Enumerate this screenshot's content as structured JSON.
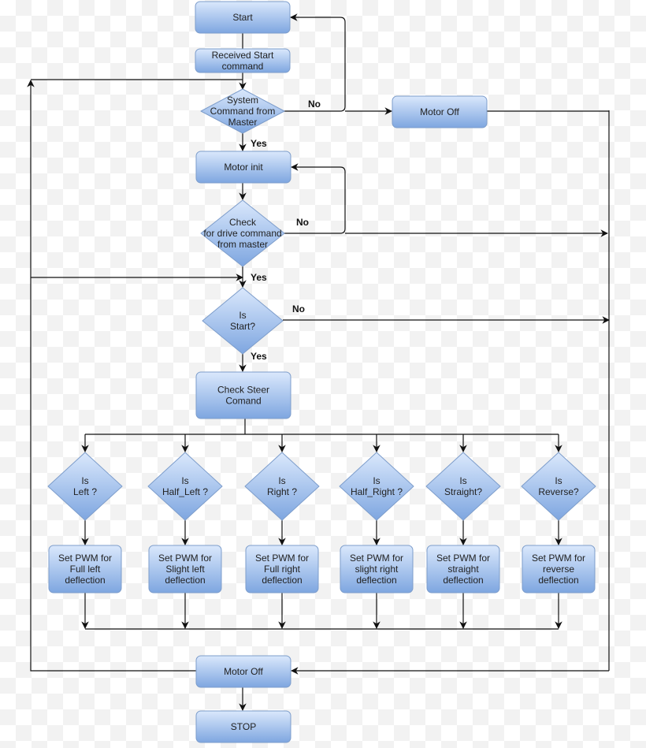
{
  "nodes": {
    "start": [
      "Start"
    ],
    "received": [
      "Received Start",
      "command"
    ],
    "system_cmd": [
      "System",
      "Command from",
      "Master"
    ],
    "motor_off_top": [
      "Motor Off"
    ],
    "motor_init": [
      "Motor init"
    ],
    "check_drive": [
      "Check",
      "for drive command",
      "from master"
    ],
    "is_start": [
      "Is",
      "Start?"
    ],
    "check_steer": [
      "Check Steer",
      "Comand"
    ],
    "is_left": [
      "Is",
      "Left ?"
    ],
    "is_half_left": [
      "Is",
      "Half_Left ?"
    ],
    "is_right": [
      "Is",
      "Right ?"
    ],
    "is_half_right": [
      "Is",
      "Half_Right ?"
    ],
    "is_straight": [
      "Is",
      "Straight?"
    ],
    "is_reverse": [
      "Is",
      "Reverse?"
    ],
    "pwm_left": [
      "Set PWM for",
      "Full left",
      "deflection"
    ],
    "pwm_half_left": [
      "Set PWM for",
      "Slight left",
      "deflection"
    ],
    "pwm_right": [
      "Set PWM for",
      "Full right",
      "deflection"
    ],
    "pwm_half_right": [
      "Set PWM for",
      "slight right",
      "deflection"
    ],
    "pwm_straight": [
      "Set PWM for",
      "straight",
      "deflection"
    ],
    "pwm_reverse": [
      "Set PWM for",
      "reverse",
      "deflection"
    ],
    "motor_off_bottom": [
      "Motor Off"
    ],
    "stop": [
      "STOP"
    ]
  },
  "edge_labels": {
    "system_no": "No",
    "system_yes": "Yes",
    "drive_no": "No",
    "drive_yes": "Yes",
    "start_no": "No",
    "start_yes": "Yes"
  },
  "colors": {
    "node_fill_top": "#dae8fc",
    "node_fill_bottom": "#7ea6e0",
    "node_stroke": "#7d9dcb",
    "edge": "#111111"
  }
}
